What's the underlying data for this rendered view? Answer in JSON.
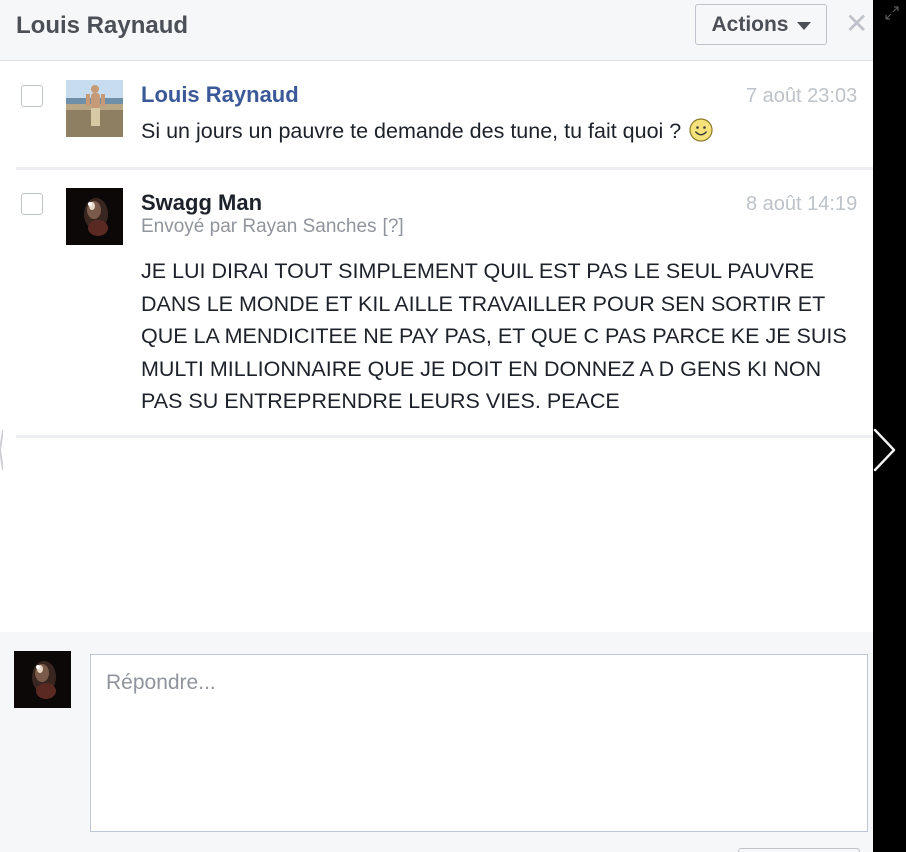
{
  "header": {
    "title": "Louis Raynaud",
    "actions_label": "Actions",
    "actions_icon": "caret-down-icon",
    "close_icon": "close-icon"
  },
  "messages": [
    {
      "sender": "Louis Raynaud",
      "time": "7 août 23:03",
      "text": "Si un jours un pauvre te demande des tune, tu fait quoi ?",
      "emoji": "smiley-emoji-icon"
    },
    {
      "sender": "Swagg Man",
      "time": "8 août 14:19",
      "sent_by": "Envoyé par Rayan Sanches",
      "help": "[?]",
      "text": "JE LUI DIRAI  TOUT SIMPLEMENT QUIL EST PAS LE SEUL PAUVRE DANS LE MONDE ET KIL AILLE TRAVAILLER POUR SEN SORTIR ET QUE LA MENDICITEE NE PAY PAS, ET QUE C PAS PARCE KE JE SUIS MULTI MILLIONNAIRE QUE JE DOIT EN DONNEZ A D GENS KI NON PAS SU ENTREPRENDRE LEURS VIES. PEACE"
    }
  ],
  "reply": {
    "placeholder": "Répondre...",
    "value": ""
  },
  "colors": {
    "link": "#3b5998",
    "header_bg": "#f6f7f9",
    "muted": "#90949c"
  }
}
